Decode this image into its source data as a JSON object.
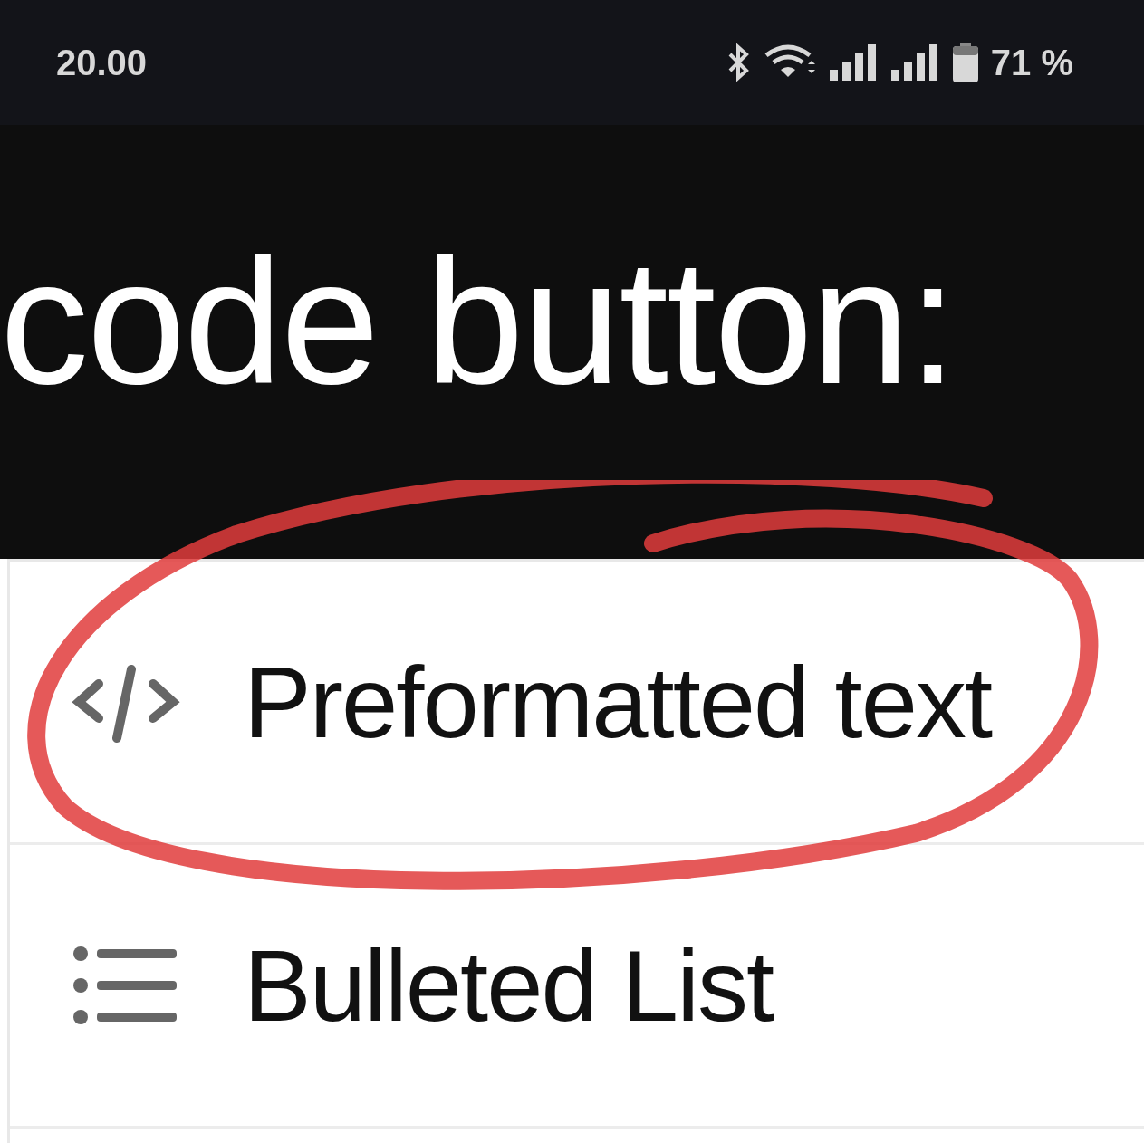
{
  "status_bar": {
    "time": "20.00",
    "battery": "71 %"
  },
  "heading": "code button:",
  "menu": {
    "items": [
      {
        "kind": "code",
        "label": "Preformatted text",
        "highlighted": true
      },
      {
        "kind": "bullets",
        "label": "Bulleted List",
        "highlighted": false
      }
    ]
  }
}
